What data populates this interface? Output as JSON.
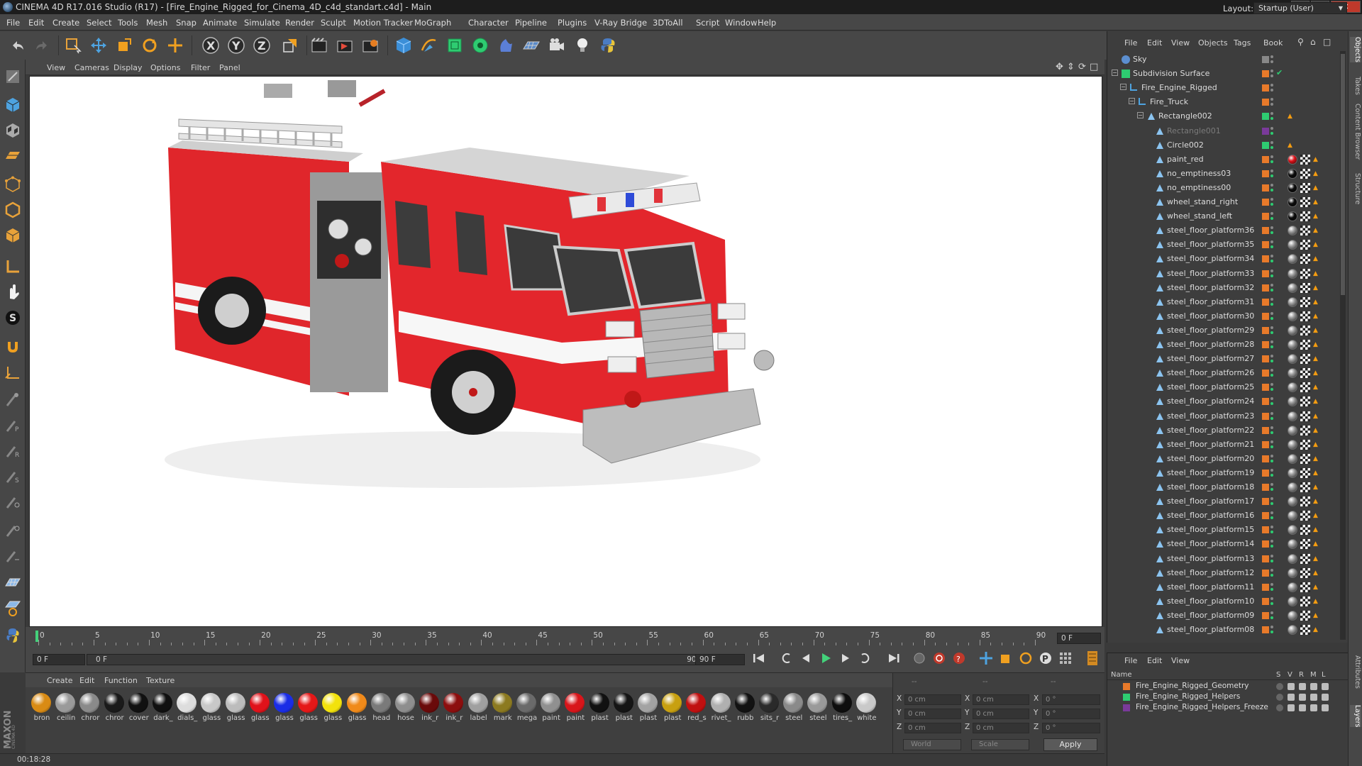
{
  "window": {
    "title": "CINEMA 4D R17.016 Studio (R17) - [Fire_Engine_Rigged_for_Cinema_4D_c4d_standart.c4d] - Main"
  },
  "menu": [
    "File",
    "Edit",
    "Create",
    "Select",
    "Tools",
    "Mesh",
    "Snap",
    "Animate",
    "Simulate",
    "Render",
    "Sculpt",
    "Motion Tracker",
    "MoGraph",
    "Character",
    "Pipeline",
    "Plugins",
    "V-Ray Bridge",
    "3DToAll",
    "Script",
    "Window",
    "Help"
  ],
  "layout": {
    "label": "Layout:",
    "value": "Startup (User)"
  },
  "viewport": {
    "menu": [
      "View",
      "Cameras",
      "Display",
      "Options",
      "Filter",
      "Panel"
    ]
  },
  "timeline": {
    "ticks": [
      "0",
      "5",
      "10",
      "15",
      "20",
      "25",
      "30",
      "35",
      "40",
      "45",
      "50",
      "55",
      "60",
      "65",
      "70",
      "75",
      "80",
      "85",
      "90"
    ],
    "current_frame": "0 F",
    "start_field": "0 F",
    "slider_start": "0 F",
    "slider_end": "90 F",
    "end_field": "90 F"
  },
  "material_manager": {
    "menu": [
      "Create",
      "Edit",
      "Function",
      "Texture"
    ],
    "materials": [
      {
        "label": "bron",
        "color": "#d98b14"
      },
      {
        "label": "ceilin",
        "color": "#9a9a9a"
      },
      {
        "label": "chror",
        "color": "#8a8a8a"
      },
      {
        "label": "chror",
        "color": "#1a1a1a"
      },
      {
        "label": "cover",
        "color": "#111111"
      },
      {
        "label": "dark_",
        "color": "#101010"
      },
      {
        "label": "dials_",
        "color": "#dddddd"
      },
      {
        "label": "glass",
        "color": "#c8c8c8"
      },
      {
        "label": "glass",
        "color": "#bcbcbc"
      },
      {
        "label": "glass",
        "color": "#e0121a"
      },
      {
        "label": "glass",
        "color": "#1a2de6"
      },
      {
        "label": "glass",
        "color": "#e51818"
      },
      {
        "label": "glass",
        "color": "#f2e20c"
      },
      {
        "label": "glass",
        "color": "#f08a1a"
      },
      {
        "label": "head",
        "color": "#7a7a7a"
      },
      {
        "label": "hose",
        "color": "#8e8e8e"
      },
      {
        "label": "ink_r",
        "color": "#6a0a0a"
      },
      {
        "label": "ink_r",
        "color": "#8c0e0e"
      },
      {
        "label": "label",
        "color": "#a0a0a0"
      },
      {
        "label": "mark",
        "color": "#8c7a20"
      },
      {
        "label": "mega",
        "color": "#6a6a6a"
      },
      {
        "label": "paint",
        "color": "#909090"
      },
      {
        "label": "paint",
        "color": "#d8151a"
      },
      {
        "label": "plast",
        "color": "#111111"
      },
      {
        "label": "plast",
        "color": "#151515"
      },
      {
        "label": "plast",
        "color": "#a3a3a3"
      },
      {
        "label": "plast",
        "color": "#c8a010"
      },
      {
        "label": "red_s",
        "color": "#c01010"
      },
      {
        "label": "rivet_",
        "color": "#b0b0b0"
      },
      {
        "label": "rubb",
        "color": "#121212"
      },
      {
        "label": "sits_r",
        "color": "#2a2a2a"
      },
      {
        "label": "steel",
        "color": "#8a8a8a"
      },
      {
        "label": "steel",
        "color": "#9a9a9a"
      },
      {
        "label": "tires_",
        "color": "#0e0e0e"
      },
      {
        "label": "white",
        "color": "#c9c9c9"
      }
    ]
  },
  "coordinates": {
    "headers": [
      "--",
      "--",
      "--"
    ],
    "rows": [
      {
        "a": "X",
        "v1": "0 cm",
        "b": "X",
        "v2": "0 cm",
        "c": "X",
        "v3": "0 °"
      },
      {
        "a": "Y",
        "v1": "0 cm",
        "b": "Y",
        "v2": "0 cm",
        "c": "Y",
        "v3": "0 °"
      },
      {
        "a": "Z",
        "v1": "0 cm",
        "b": "Z",
        "v2": "0 cm",
        "c": "Z",
        "v3": "0 °"
      }
    ],
    "mode": "World",
    "scale": "Scale",
    "apply": "Apply"
  },
  "status": {
    "time": "00:18:28"
  },
  "object_manager": {
    "menu": [
      "File",
      "Edit",
      "View",
      "Objects",
      "Tags",
      "Book"
    ],
    "objects": [
      {
        "name": "Sky",
        "depth": 0,
        "color": "#888888",
        "tag": "none"
      },
      {
        "name": "Subdivision Surface",
        "depth": 0,
        "color": "#e87a2a",
        "tag": "check"
      },
      {
        "name": "Fire_Engine_Rigged",
        "depth": 1,
        "color": "#e87a2a",
        "tag": "none"
      },
      {
        "name": "Fire_Truck",
        "depth": 2,
        "color": "#e87a2a",
        "tag": "none"
      },
      {
        "name": "Rectangle002",
        "depth": 3,
        "color": "#2ecc71",
        "tag": "tri"
      },
      {
        "name": "Rectangle001",
        "depth": 4,
        "color": "#7a3a9a",
        "tag": "none"
      },
      {
        "name": "Circle002",
        "depth": 4,
        "color": "#2ecc71",
        "tag": "tri"
      },
      {
        "name": "paint_red",
        "depth": 4,
        "color": "#e87a2a",
        "tag": "red"
      },
      {
        "name": "no_emptiness03",
        "depth": 4,
        "color": "#e87a2a",
        "tag": "black"
      },
      {
        "name": "no_emptiness00",
        "depth": 4,
        "color": "#e87a2a",
        "tag": "black"
      },
      {
        "name": "wheel_stand_right",
        "depth": 4,
        "color": "#e87a2a",
        "tag": "black"
      },
      {
        "name": "wheel_stand_left",
        "depth": 4,
        "color": "#e87a2a",
        "tag": "black"
      },
      {
        "name": "steel_floor_platform36",
        "depth": 4,
        "color": "#e87a2a",
        "tag": "steel"
      },
      {
        "name": "steel_floor_platform35",
        "depth": 4,
        "color": "#e87a2a",
        "tag": "steel"
      },
      {
        "name": "steel_floor_platform34",
        "depth": 4,
        "color": "#e87a2a",
        "tag": "steel"
      },
      {
        "name": "steel_floor_platform33",
        "depth": 4,
        "color": "#e87a2a",
        "tag": "steel"
      },
      {
        "name": "steel_floor_platform32",
        "depth": 4,
        "color": "#e87a2a",
        "tag": "steel"
      },
      {
        "name": "steel_floor_platform31",
        "depth": 4,
        "color": "#e87a2a",
        "tag": "steel"
      },
      {
        "name": "steel_floor_platform30",
        "depth": 4,
        "color": "#e87a2a",
        "tag": "steel"
      },
      {
        "name": "steel_floor_platform29",
        "depth": 4,
        "color": "#e87a2a",
        "tag": "steel"
      },
      {
        "name": "steel_floor_platform28",
        "depth": 4,
        "color": "#e87a2a",
        "tag": "steel"
      },
      {
        "name": "steel_floor_platform27",
        "depth": 4,
        "color": "#e87a2a",
        "tag": "steel"
      },
      {
        "name": "steel_floor_platform26",
        "depth": 4,
        "color": "#e87a2a",
        "tag": "steel"
      },
      {
        "name": "steel_floor_platform25",
        "depth": 4,
        "color": "#e87a2a",
        "tag": "steel"
      },
      {
        "name": "steel_floor_platform24",
        "depth": 4,
        "color": "#e87a2a",
        "tag": "steel"
      },
      {
        "name": "steel_floor_platform23",
        "depth": 4,
        "color": "#e87a2a",
        "tag": "steel"
      },
      {
        "name": "steel_floor_platform22",
        "depth": 4,
        "color": "#e87a2a",
        "tag": "steel"
      },
      {
        "name": "steel_floor_platform21",
        "depth": 4,
        "color": "#e87a2a",
        "tag": "steel"
      },
      {
        "name": "steel_floor_platform20",
        "depth": 4,
        "color": "#e87a2a",
        "tag": "steel"
      },
      {
        "name": "steel_floor_platform19",
        "depth": 4,
        "color": "#e87a2a",
        "tag": "steel"
      },
      {
        "name": "steel_floor_platform18",
        "depth": 4,
        "color": "#e87a2a",
        "tag": "steel"
      },
      {
        "name": "steel_floor_platform17",
        "depth": 4,
        "color": "#e87a2a",
        "tag": "steel"
      },
      {
        "name": "steel_floor_platform16",
        "depth": 4,
        "color": "#e87a2a",
        "tag": "steel"
      },
      {
        "name": "steel_floor_platform15",
        "depth": 4,
        "color": "#e87a2a",
        "tag": "steel"
      },
      {
        "name": "steel_floor_platform14",
        "depth": 4,
        "color": "#e87a2a",
        "tag": "steel"
      },
      {
        "name": "steel_floor_platform13",
        "depth": 4,
        "color": "#e87a2a",
        "tag": "steel"
      },
      {
        "name": "steel_floor_platform12",
        "depth": 4,
        "color": "#e87a2a",
        "tag": "steel"
      },
      {
        "name": "steel_floor_platform11",
        "depth": 4,
        "color": "#e87a2a",
        "tag": "steel"
      },
      {
        "name": "steel_floor_platform10",
        "depth": 4,
        "color": "#e87a2a",
        "tag": "steel"
      },
      {
        "name": "steel_floor_platform09",
        "depth": 4,
        "color": "#e87a2a",
        "tag": "steel"
      },
      {
        "name": "steel_floor_platform08",
        "depth": 4,
        "color": "#e87a2a",
        "tag": "steel"
      }
    ]
  },
  "layer_manager": {
    "menu": [
      "File",
      "Edit",
      "View"
    ],
    "header": {
      "name": "Name",
      "cols": [
        "S",
        "V",
        "R",
        "M",
        "L"
      ]
    },
    "layers": [
      {
        "name": "Fire_Engine_Rigged_Geometry",
        "color": "#e87a2a"
      },
      {
        "name": "Fire_Engine_Rigged_Helpers",
        "color": "#2ecc71"
      },
      {
        "name": "Fire_Engine_Rigged_Helpers_Freeze",
        "color": "#7a3a9a"
      }
    ]
  },
  "side_tabs": [
    "Objects",
    "Takes",
    "Content Browser",
    "Structure",
    "Attributes",
    "Layers"
  ]
}
